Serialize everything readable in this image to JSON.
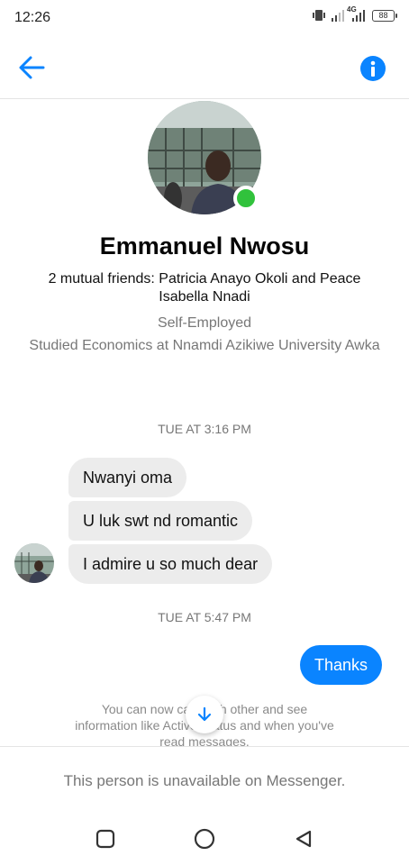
{
  "status_bar": {
    "time": "12:26",
    "network": "4G",
    "battery": "88"
  },
  "header": {
    "back_icon": "arrow-left-icon",
    "info_icon": "info-icon",
    "accent_color": "#0a84ff"
  },
  "profile": {
    "name": "Emmanuel Nwosu",
    "mutual_friends": "2 mutual friends: Patricia Anayo Okoli and Peace Isabella Nnadi",
    "work": "Self-Employed",
    "education": "Studied Economics at Nnamdi Azikiwe University Awka",
    "online_color": "#31c23c"
  },
  "conversation": {
    "timestamp_1": "TUE AT 3:16 PM",
    "incoming": [
      "Nwanyi oma",
      "U luk swt nd romantic",
      "I admire u so much dear"
    ],
    "timestamp_2": "TUE AT 5:47 PM",
    "outgoing": [
      "Thanks"
    ],
    "notice": "You can now call each other and see information like Active Status and when you've read messages."
  },
  "footer": {
    "unavailable_text": "This person is unavailable on Messenger."
  },
  "nav": {
    "icons": [
      "square-recents-icon",
      "circle-home-icon",
      "triangle-back-icon"
    ]
  }
}
